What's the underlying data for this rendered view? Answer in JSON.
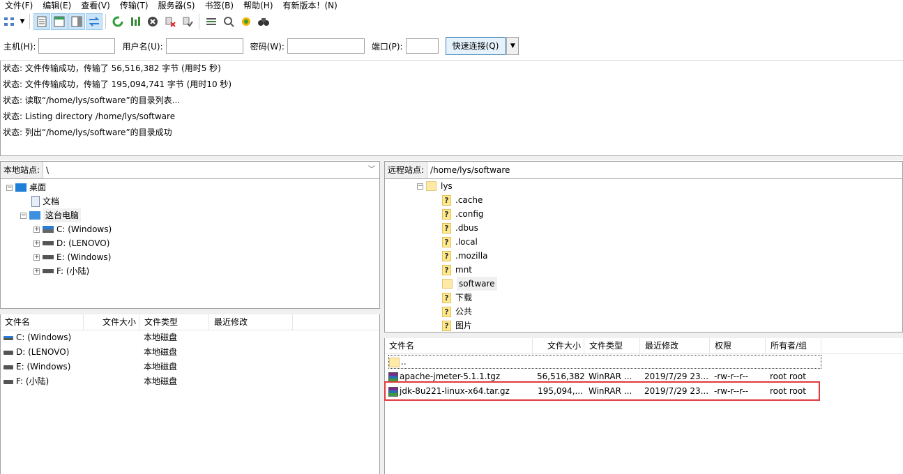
{
  "menu": [
    "文件(F)",
    "编辑(E)",
    "查看(V)",
    "传输(T)",
    "服务器(S)",
    "书签(B)",
    "帮助(H)",
    "有新版本！(N)"
  ],
  "toolbar_icons": [
    "site-manager-icon",
    "dropdown-arrow-icon",
    "toggle-log-icon",
    "toggle-local-tree-icon",
    "toggle-remote-tree-icon",
    "toggle-queue-icon",
    "refresh-icon",
    "process-queue-icon",
    "cancel-icon",
    "disconnect-icon",
    "reconnect-icon",
    "filter-icon",
    "compare-icon",
    "sync-browse-icon",
    "search-icon"
  ],
  "quickconnect": {
    "host_label": "主机(H):",
    "host_value": "",
    "user_label": "用户名(U):",
    "user_value": "",
    "pass_label": "密码(W):",
    "pass_value": "",
    "port_label": "端口(P):",
    "port_value": "",
    "button": "快速连接(Q)"
  },
  "log": [
    "状态:\t文件传输成功，传输了 56,516,382 字节 (用时5 秒)",
    "状态:\t文件传输成功，传输了 195,094,741 字节 (用时10 秒)",
    "状态:\t读取“/home/lys/software”的目录列表...",
    "状态:\tListing directory /home/lys/software",
    "状态:\t列出“/home/lys/software”的目录成功"
  ],
  "local": {
    "site_label": "本地站点:",
    "path": "\\",
    "tree": [
      {
        "label": "桌面",
        "icon": "desktop-icon"
      },
      {
        "label": "文档",
        "icon": "document-icon"
      },
      {
        "label": "这台电脑",
        "icon": "computer-icon"
      },
      {
        "label": "C: (Windows)",
        "icon": "network-drive-icon"
      },
      {
        "label": "D: (LENOVO)",
        "icon": "drive-icon"
      },
      {
        "label": "E: (Windows)",
        "icon": "drive-icon"
      },
      {
        "label": "F: (小陆)",
        "icon": "drive-icon"
      }
    ],
    "columns": [
      "文件名",
      "文件大小",
      "文件类型",
      "最近修改"
    ],
    "files": [
      {
        "name": "C: (Windows)",
        "size": "",
        "type": "本地磁盘",
        "modified": ""
      },
      {
        "name": "D: (LENOVO)",
        "size": "",
        "type": "本地磁盘",
        "modified": ""
      },
      {
        "name": "E: (Windows)",
        "size": "",
        "type": "本地磁盘",
        "modified": ""
      },
      {
        "name": "F: (小陆)",
        "size": "",
        "type": "本地磁盘",
        "modified": ""
      }
    ]
  },
  "remote": {
    "site_label": "远程站点:",
    "path": "/home/lys/software",
    "tree": [
      {
        "label": "lys",
        "icon": "folder-icon"
      },
      {
        "label": ".cache",
        "icon": "unknown-folder-icon"
      },
      {
        "label": ".config",
        "icon": "unknown-folder-icon"
      },
      {
        "label": ".dbus",
        "icon": "unknown-folder-icon"
      },
      {
        "label": ".local",
        "icon": "unknown-folder-icon"
      },
      {
        "label": ".mozilla",
        "icon": "unknown-folder-icon"
      },
      {
        "label": "mnt",
        "icon": "unknown-folder-icon"
      },
      {
        "label": "software",
        "icon": "folder-icon"
      },
      {
        "label": "下载",
        "icon": "unknown-folder-icon"
      },
      {
        "label": "公共",
        "icon": "unknown-folder-icon"
      },
      {
        "label": "图片",
        "icon": "unknown-folder-icon"
      }
    ],
    "columns": [
      "文件名",
      "文件大小",
      "文件类型",
      "最近修改",
      "权限",
      "所有者/组"
    ],
    "parent": "..",
    "files": [
      {
        "name": "apache-jmeter-5.1.1.tgz",
        "size": "56,516,382",
        "type": "WinRAR ...",
        "modified": "2019/7/29 23...",
        "perm": "-rw-r--r--",
        "owner": "root root"
      },
      {
        "name": "jdk-8u221-linux-x64.tar.gz",
        "size": "195,094,...",
        "type": "WinRAR ...",
        "modified": "2019/7/29 23...",
        "perm": "-rw-r--r--",
        "owner": "root root"
      }
    ]
  },
  "colors": {
    "highlight": "#e0393e",
    "selection": "#cce4f7"
  }
}
